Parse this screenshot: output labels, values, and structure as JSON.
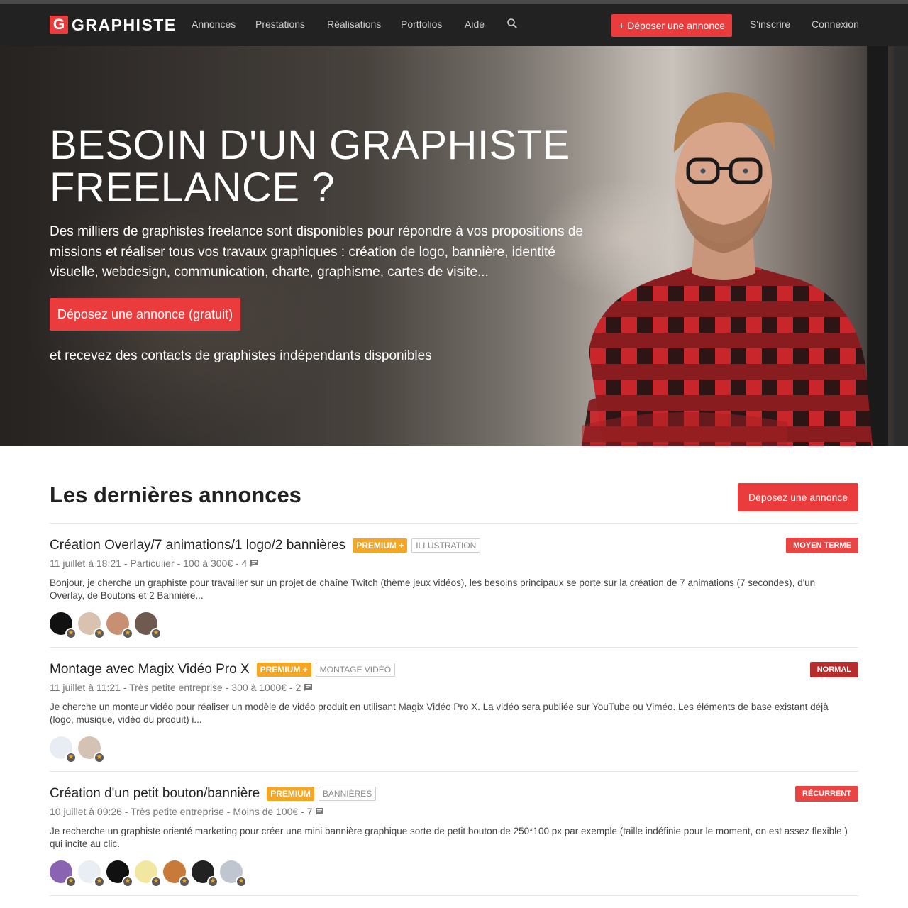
{
  "brand": {
    "logo_letter": "G",
    "name": "GRAPHISTE",
    "accent": "#ea3c3c"
  },
  "nav": {
    "links": [
      "Annonces",
      "Prestations",
      "Réalisations",
      "Portfolios",
      "Aide"
    ],
    "search_icon": "search-icon",
    "cta": "+ Déposer une annonce",
    "signup": "S'inscrire",
    "login": "Connexion"
  },
  "hero": {
    "title_line1": "BESOIN D'UN GRAPHISTE",
    "title_line2": "FREELANCE ?",
    "description": "Des milliers de graphistes freelance sont disponibles pour répondre à vos propositions de missions et réaliser tous vos travaux graphiques : création de logo, bannière, identité visuelle, webdesign, communication, charte, graphisme, cartes de visite...",
    "cta": "Déposez une annonce (gratuit)",
    "subtext": "et recevez des contacts de graphistes indépendants disponibles"
  },
  "listings": {
    "title": "Les dernières annonces",
    "cta": "Déposez une annonce",
    "items": [
      {
        "title": "Création Overlay/7 animations/1 logo/2 bannières",
        "premium": "PREMIUM +",
        "category": "ILLUSTRATION",
        "term": "MOYEN TERME",
        "term_color": "#e84545",
        "meta": "11 juillet à 18:21 - Particulier - 100 à 300€ - 4",
        "description": "Bonjour, je cherche un graphiste pour travailler sur un projet de chaîne Twitch (thème jeux vidéos), les besoins principaux se porte sur la création de 7 animations (7 secondes), d'un Overlay, de Boutons et 2 Bannière...",
        "avatar_colors": [
          "#111111",
          "#d9c3b0",
          "#c98f72",
          "#6e5a4f"
        ]
      },
      {
        "title": "Montage avec Magix Vidéo Pro X",
        "premium": "PREMIUM +",
        "category": "MONTAGE VIDÉO",
        "term": "NORMAL",
        "term_color": "#b52d2d",
        "meta": "11 juillet à 11:21 - Très petite entreprise - 300 à 1000€ - 2",
        "description": "Je cherche un monteur vidéo pour réaliser un modèle de vidéo produit en utilisant Magix Vidéo Pro X. La vidéo sera publiée sur YouTube ou Viméo. Les éléments de base existant déjà (logo, musique, vidéo du produit) i...",
        "avatar_colors": [
          "#e8edf3",
          "#d6c2b3"
        ]
      },
      {
        "title": "Création d'un petit bouton/bannière",
        "premium": "PREMIUM",
        "category": "BANNIÈRES",
        "term": "RÉCURRENT",
        "term_color": "#e84545",
        "meta": "10 juillet à 09:26 - Très petite entreprise - Moins de 100€ - 7",
        "description": "Je recherche un graphiste orienté marketing pour créer une mini bannière graphique sorte de petit bouton de 250*100 px par exemple (taille indéfinie pour le moment, on est assez flexible ) qui incite au clic.",
        "avatar_colors": [
          "#8a63b3",
          "#e9eef5",
          "#111111",
          "#f2e7a1",
          "#c77a3a",
          "#222222",
          "#bfc6cf"
        ]
      }
    ]
  }
}
